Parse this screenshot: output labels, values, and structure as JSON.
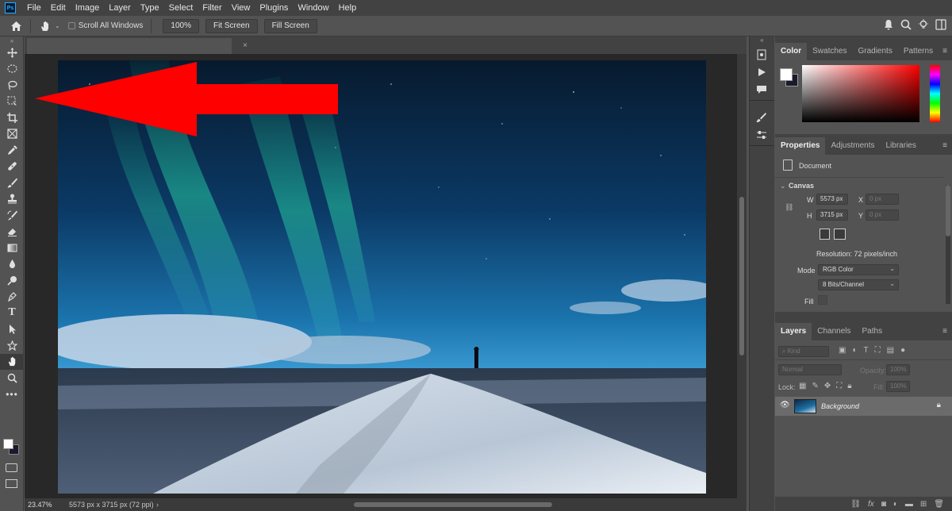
{
  "menu": {
    "logo": "Ps",
    "items": [
      "File",
      "Edit",
      "Image",
      "Layer",
      "Type",
      "Select",
      "Filter",
      "View",
      "Plugins",
      "Window",
      "Help"
    ]
  },
  "options": {
    "scroll_all_windows": "Scroll All Windows",
    "zoom_100": "100%",
    "fit_screen": "Fit Screen",
    "fill_screen": "Fill Screen"
  },
  "document": {
    "tab_close": "×"
  },
  "status": {
    "zoom": "23.47%",
    "info": "5573 px x 3715 px (72 ppi)",
    "arrow": "›"
  },
  "color_panel": {
    "tabs": [
      "Color",
      "Swatches",
      "Gradients",
      "Patterns"
    ],
    "fg_color": "#ffffff",
    "bg_color": "#1a1a2e"
  },
  "properties_panel": {
    "tabs": [
      "Properties",
      "Adjustments",
      "Libraries"
    ],
    "document_label": "Document",
    "canvas_label": "Canvas",
    "w_label": "W",
    "w_value": "5573 px",
    "h_label": "H",
    "h_value": "3715 px",
    "x_label": "X",
    "x_value": "0 px",
    "y_label": "Y",
    "y_value": "0 px",
    "resolution": "Resolution: 72 pixels/inch",
    "mode_label": "Mode",
    "mode_value": "RGB Color",
    "bits_value": "8 Bits/Channel",
    "fill_label": "Fill"
  },
  "layers_panel": {
    "tabs": [
      "Layers",
      "Channels",
      "Paths"
    ],
    "kind_placeholder": "Kind",
    "blend_mode": "Normal",
    "opacity_label": "Opacity:",
    "opacity_value": "100%",
    "lock_label": "Lock:",
    "fill_label": "Fill:",
    "fill_value": "100%",
    "layer_name": "Background"
  },
  "annotation": {
    "arrow_color": "#ff0000"
  }
}
